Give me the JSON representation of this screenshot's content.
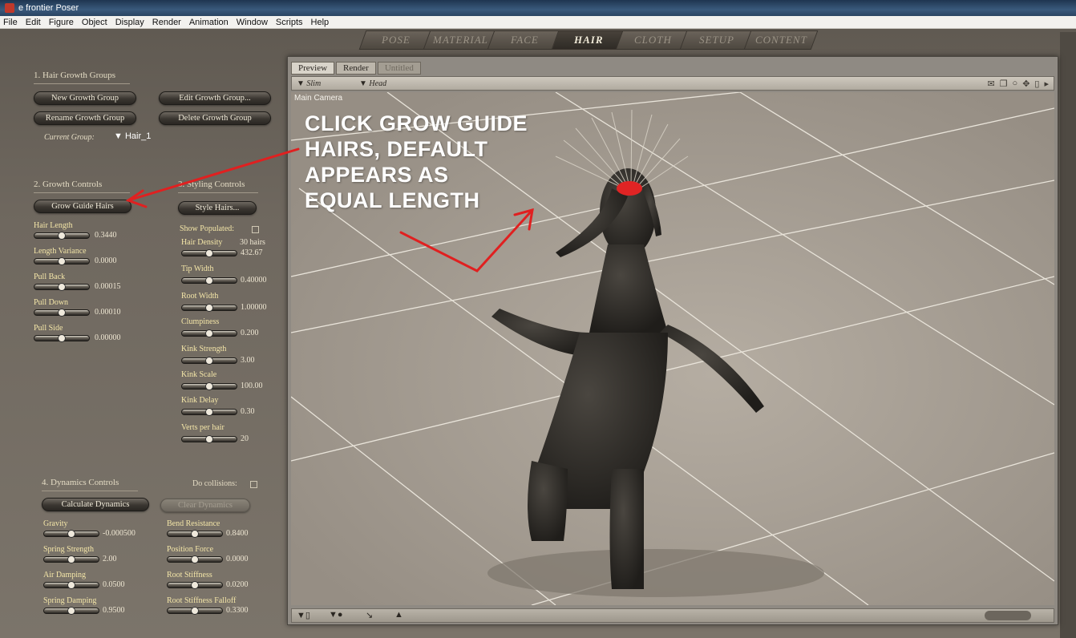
{
  "app": {
    "title": "e frontier Poser"
  },
  "menu": [
    "File",
    "Edit",
    "Figure",
    "Object",
    "Display",
    "Render",
    "Animation",
    "Window",
    "Scripts",
    "Help"
  ],
  "room_tabs": [
    {
      "label": "POSE"
    },
    {
      "label": "MATERIAL"
    },
    {
      "label": "FACE"
    },
    {
      "label": "HAIR",
      "active": true
    },
    {
      "label": "CLOTH"
    },
    {
      "label": "SETUP"
    },
    {
      "label": "CONTENT"
    }
  ],
  "growth_groups": {
    "title": "1. Hair Growth Groups",
    "new_btn": "New Growth Group",
    "edit_btn": "Edit Growth Group...",
    "rename_btn": "Rename Growth Group",
    "delete_btn": "Delete Growth Group",
    "current_label": "Current Group:",
    "current_value": "Hair_1"
  },
  "growth_controls": {
    "title": "2. Growth Controls",
    "grow_btn": "Grow Guide Hairs",
    "params": [
      {
        "label": "Hair Length",
        "value": "0.3440"
      },
      {
        "label": "Length Variance",
        "value": "0.0000"
      },
      {
        "label": "Pull Back",
        "value": "0.00015"
      },
      {
        "label": "Pull Down",
        "value": "0.00010"
      },
      {
        "label": "Pull Side",
        "value": "0.00000"
      }
    ]
  },
  "styling_controls": {
    "title": "3. Styling Controls",
    "style_btn": "Style Hairs...",
    "show_populated": "Show Populated:",
    "density_suffix": "30 hairs",
    "params": [
      {
        "label": "Hair Density",
        "value": "432.67"
      },
      {
        "label": "Tip Width",
        "value": "0.40000"
      },
      {
        "label": "Root Width",
        "value": "1.00000"
      },
      {
        "label": "Clumpiness",
        "value": "0.200"
      },
      {
        "label": "Kink Strength",
        "value": "3.00"
      },
      {
        "label": "Kink Scale",
        "value": "100.00"
      },
      {
        "label": "Kink Delay",
        "value": "0.30"
      },
      {
        "label": "Verts per hair",
        "value": "20"
      }
    ]
  },
  "dynamics": {
    "title": "4. Dynamics Controls",
    "collisions_label": "Do collisions:",
    "calc_btn": "Calculate Dynamics",
    "clear_btn": "Clear Dynamics",
    "left_params": [
      {
        "label": "Gravity",
        "value": "-0.000500"
      },
      {
        "label": "Spring Strength",
        "value": "2.00"
      },
      {
        "label": "Air Damping",
        "value": "0.0500"
      },
      {
        "label": "Spring Damping",
        "value": "0.9500"
      }
    ],
    "right_params": [
      {
        "label": "Bend Resistance",
        "value": "0.8400"
      },
      {
        "label": "Position Force",
        "value": "0.0000"
      },
      {
        "label": "Root Stiffness",
        "value": "0.0200"
      },
      {
        "label": "Root Stiffness Falloff",
        "value": "0.3300"
      }
    ]
  },
  "viewport": {
    "tabs": [
      {
        "label": "Preview",
        "state": "active"
      },
      {
        "label": "Render",
        "state": "normal"
      },
      {
        "label": "Untitled",
        "state": "dim"
      }
    ],
    "dropdown_left": "Slim",
    "dropdown_right": "Head",
    "camera_label": "Main Camera"
  },
  "annotation": {
    "lines": [
      "CLICK GROW GUIDE",
      "HAIRS, DEFAULT",
      "APPEARS AS",
      "EQUAL LENGTH"
    ],
    "color": "#e02020"
  },
  "colors": {
    "panel_label": "#f4e6a8",
    "floor": "#aea59a",
    "figure": "#2e2b27",
    "hair_root": "#e02424"
  }
}
